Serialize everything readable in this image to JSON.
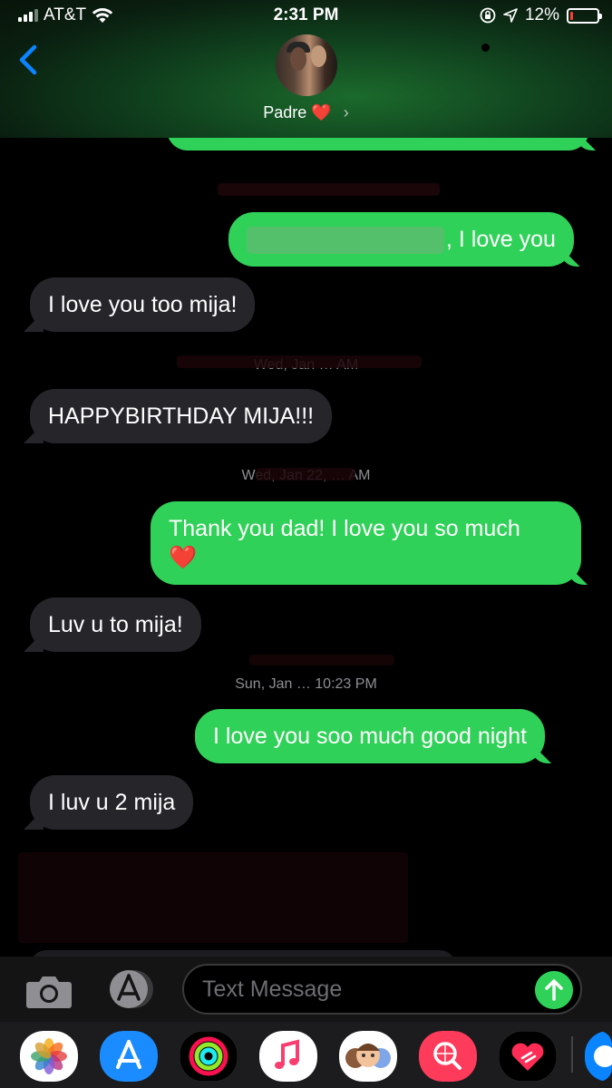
{
  "status_bar": {
    "carrier": "AT&T",
    "time": "2:31 PM",
    "battery_percent": "12%",
    "battery_level": 0.12,
    "battery_color": "#ff3b30",
    "signal_bars": 3
  },
  "header": {
    "back_icon": "chevron-left-icon",
    "contact_name": "Padre",
    "contact_heart": "❤️",
    "contact_chevron": "›"
  },
  "messages": [
    {
      "side": "out",
      "text": ", I love you",
      "redacted_prefix": true
    },
    {
      "side": "in",
      "text": "I love you too mija!"
    },
    {
      "side": "in",
      "text": "HAPPYBIRTHDAY MIJA!!!"
    },
    {
      "side": "out",
      "text": "Thank you dad! I love you so much",
      "emoji": "❤️"
    },
    {
      "side": "in",
      "text": "Luv u to mija!"
    },
    {
      "side": "out",
      "text": "I love you soo much good night"
    },
    {
      "side": "in",
      "text": "I luv u 2 mija"
    }
  ],
  "timestamps": [
    {
      "text": "Wed, Jan … AM"
    },
    {
      "text": "Wed, Jan 22, … AM"
    },
    {
      "text": "Sun, Jan … 10:23 PM"
    }
  ],
  "input": {
    "placeholder": "Text Message",
    "camera_icon": "camera-icon",
    "apps_icon": "app-store-icon",
    "send_icon": "arrow-up-icon"
  },
  "app_drawer": [
    "photos-icon",
    "app-store-icon",
    "activity-icon",
    "music-icon",
    "memoji-icon",
    "search-images-icon",
    "digital-touch-icon",
    "more-apps-icon"
  ],
  "colors": {
    "outgoing_bubble": "#30d158",
    "incoming_bubble": "#26252a",
    "background": "#000000",
    "timestamp": "#8e8e93",
    "accent_blue": "#0a84ff"
  }
}
